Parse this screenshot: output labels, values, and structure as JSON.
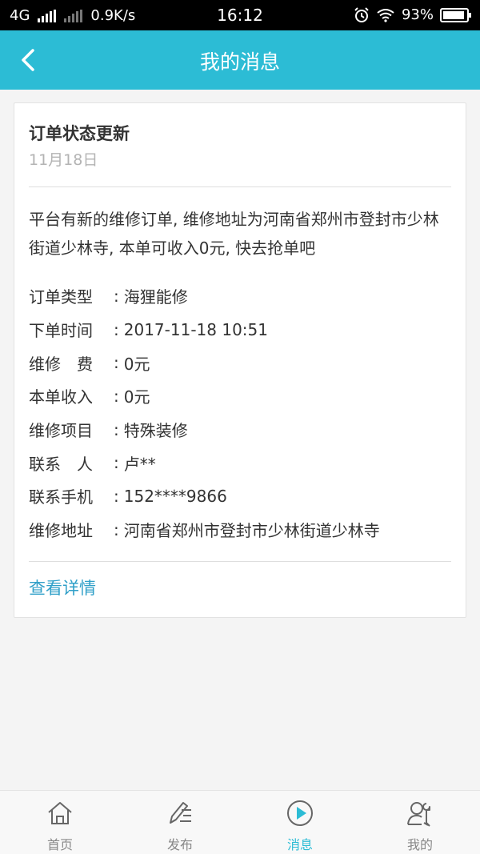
{
  "status_bar": {
    "network": "4G",
    "speed": "0.9K/s",
    "time": "16:12",
    "battery": "93%",
    "battery_level": 0.93
  },
  "header": {
    "title": "我的消息"
  },
  "message": {
    "title": "订单状态更新",
    "date": "11月18日",
    "body": "平台有新的维修订单, 维修地址为河南省郑州市登封市少林街道少林寺, 本单可收入0元, 快去抢单吧",
    "fields": [
      {
        "label": "订单类型",
        "value": "海狸能修"
      },
      {
        "label": "下单时间",
        "value": "2017-11-18 10:51"
      },
      {
        "label": "维修　费",
        "value": "0元"
      },
      {
        "label": "本单收入",
        "value": "0元"
      },
      {
        "label": "维修项目",
        "value": "特殊装修"
      },
      {
        "label": "联系　人",
        "value": "卢**"
      },
      {
        "label": "联系手机",
        "value": "152****9866"
      },
      {
        "label": "维修地址",
        "value": "河南省郑州市登封市少林街道少林寺"
      }
    ],
    "link": "查看详情"
  },
  "tabbar": {
    "items": [
      {
        "label": "首页",
        "icon": "home-icon",
        "active": false
      },
      {
        "label": "发布",
        "icon": "pen-icon",
        "active": false
      },
      {
        "label": "消息",
        "icon": "message-play-icon",
        "active": true
      },
      {
        "label": "我的",
        "icon": "user-wrench-icon",
        "active": false
      }
    ]
  },
  "colors": {
    "accent": "#2cbcd5",
    "link": "#2f9fc8",
    "inactive": "#888888"
  }
}
